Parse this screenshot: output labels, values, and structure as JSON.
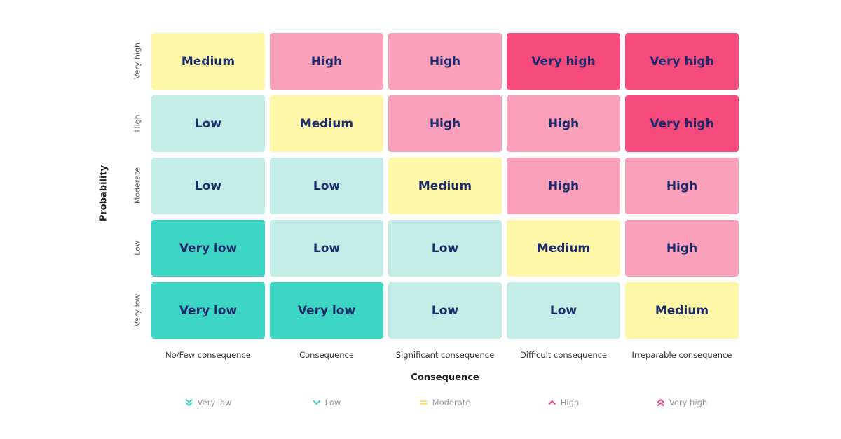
{
  "chart_data": {
    "type": "heatmap",
    "title": "",
    "xlabel": "Consequence",
    "ylabel": "Probability",
    "x_categories": [
      "No/Few consequence",
      "Consequence",
      "Significant consequence",
      "Difficult consequence",
      "Irreparable consequence"
    ],
    "y_categories": [
      "Very high",
      "High",
      "Moderate",
      "Low",
      "Very low"
    ],
    "cells": [
      [
        "Medium",
        "High",
        "High",
        "Very high",
        "Very high"
      ],
      [
        "Low",
        "Medium",
        "High",
        "High",
        "Very high"
      ],
      [
        "Low",
        "Low",
        "Medium",
        "High",
        "High"
      ],
      [
        "Very low",
        "Low",
        "Low",
        "Medium",
        "High"
      ],
      [
        "Very low",
        "Very low",
        "Low",
        "Low",
        "Medium"
      ]
    ],
    "level_colors": {
      "Very low": "#3dd5c4",
      "Low": "#c4ede8",
      "Medium": "#fff7a8",
      "High": "#fba0bb",
      "Very high": "#f44b7c"
    },
    "legend": [
      {
        "label": "Very low",
        "icon": "double-chevron-down-icon",
        "color": "#3dd5c4"
      },
      {
        "label": "Low",
        "icon": "chevron-down-icon",
        "color": "#3dd5c4"
      },
      {
        "label": "Moderate",
        "icon": "equals-icon",
        "color": "#f6e36a"
      },
      {
        "label": "High",
        "icon": "chevron-up-icon",
        "color": "#f44b7c"
      },
      {
        "label": "Very high",
        "icon": "double-chevron-up-icon",
        "color": "#f44b7c"
      }
    ],
    "legend_position": "bottom",
    "grid": false
  }
}
